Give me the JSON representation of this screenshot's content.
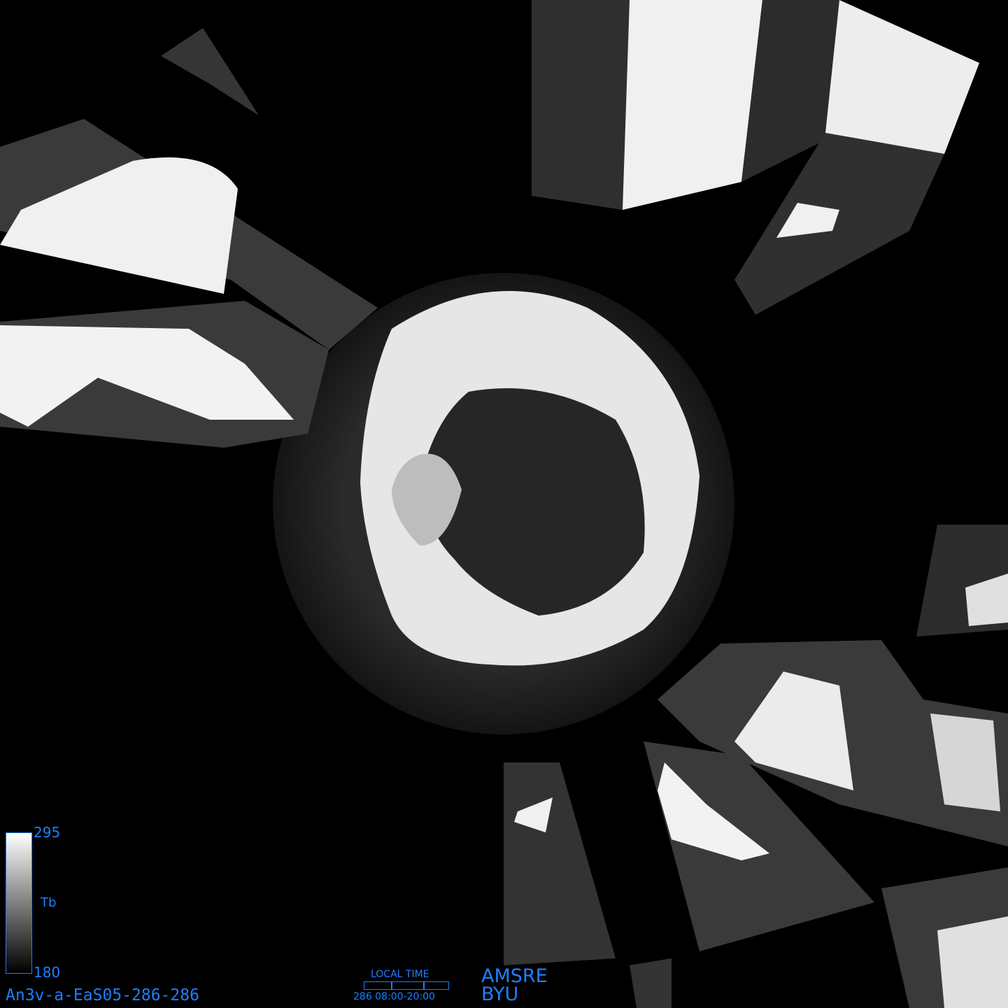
{
  "image": {
    "description_colors": {
      "label": "#1e7fff",
      "background": "#000000"
    }
  },
  "colorbar": {
    "max": "295",
    "min": "180",
    "label": "Tb"
  },
  "product_id": "An3v-a-EaS05-286-286",
  "local_time": {
    "title": "LOCAL TIME",
    "range": "286  08:00-20:00"
  },
  "sensor": "AMSRE",
  "org": "BYU"
}
